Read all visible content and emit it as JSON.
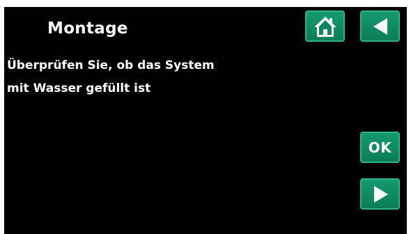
{
  "screen": {
    "title": "Montage",
    "message_lines": [
      "Überprüfen Sie, ob das System",
      "mit Wasser gefüllt ist"
    ]
  },
  "buttons": {
    "home": {
      "icon": "home-icon"
    },
    "back": {
      "icon": "arrow-left-icon"
    },
    "ok": {
      "label": "OK"
    },
    "next": {
      "icon": "arrow-right-icon"
    }
  },
  "colors": {
    "background": "#000000",
    "text": "#ffffff",
    "button_fill": "#118a63",
    "button_border": "#2fb487"
  }
}
